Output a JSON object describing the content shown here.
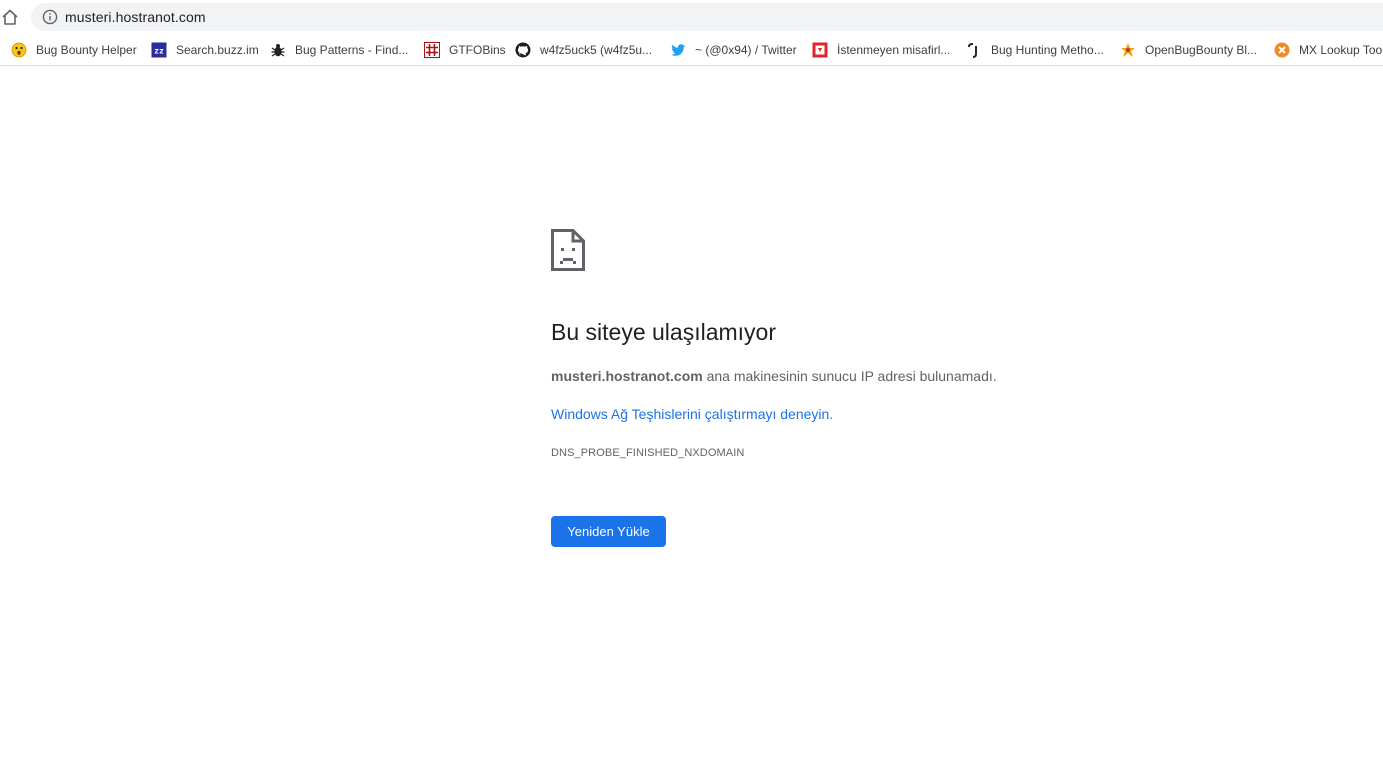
{
  "browser": {
    "url": "musteri.hostranot.com"
  },
  "bookmarks": [
    {
      "label": "Bug Bounty Helper",
      "icon": "surprised-face-icon"
    },
    {
      "label": "Search.buzz.im",
      "icon": "zz-logo-icon"
    },
    {
      "label": "Bug Patterns - Find...",
      "icon": "bug-icon"
    },
    {
      "label": "GTFOBins",
      "icon": "grid-hash-icon"
    },
    {
      "label": "w4fz5uck5 (w4fz5u...",
      "icon": "github-icon"
    },
    {
      "label": "~ (@0x94) / Twitter",
      "icon": "twitter-bird-icon"
    },
    {
      "label": "İstenmeyen misafirl...",
      "icon": "red-square-icon"
    },
    {
      "label": "Bug Hunting Metho...",
      "icon": "hook-icon"
    },
    {
      "label": "OpenBugBounty Bl...",
      "icon": "openbugbounty-icon"
    },
    {
      "label": "MX Lookup Tool",
      "icon": "mxtoolbox-icon"
    }
  ],
  "error": {
    "icon": "sad-page-icon",
    "title": "Bu siteye ulaşılamıyor",
    "host": "musteri.hostranot.com",
    "description_rest": " ana makinesinin sunucu IP adresi bulunamadı.",
    "suggestion_link": "Windows Ağ Teşhislerini çalıştırmayı deneyin.",
    "code": "DNS_PROBE_FINISHED_NXDOMAIN",
    "reload_button": "Yeniden Yükle"
  },
  "colors": {
    "accent": "#1a73e8",
    "omnibox_bg": "#f1f3f4",
    "text_secondary": "#5f6368"
  }
}
